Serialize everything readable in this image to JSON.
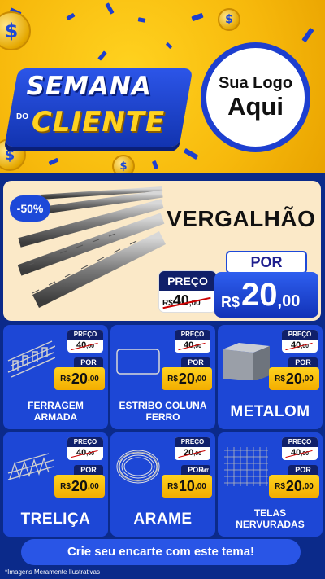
{
  "header": {
    "headline_top": "SEMANA",
    "headline_small": "DO",
    "headline_bottom": "CLIENTE",
    "coin_symbol": "$",
    "logo_line1": "Sua Logo",
    "logo_line2": "Aqui"
  },
  "featured": {
    "discount": "-50%",
    "title": "VERGALHÃO",
    "old_label": "PREÇO",
    "old_currency": "R$",
    "old_int": "40",
    "old_dec": ",00",
    "por_label": "POR",
    "new_currency": "R$",
    "new_int": "20",
    "new_dec": ",00"
  },
  "cards": [
    {
      "name": "FERRAGEM ARMADA",
      "old_label": "PREÇO",
      "old_int": "40",
      "old_dec": ",00",
      "por": "POR",
      "cur": "R$",
      "new_int": "20",
      "new_dec": ",00"
    },
    {
      "name": "ESTRIBO COLUNA FERRO",
      "old_label": "PREÇO",
      "old_int": "40",
      "old_dec": ",00",
      "por": "POR",
      "cur": "R$",
      "new_int": "20",
      "new_dec": ",00"
    },
    {
      "name": "METALOM",
      "old_label": "PREÇO",
      "old_int": "40",
      "old_dec": ",00",
      "por": "POR",
      "cur": "R$",
      "new_int": "20",
      "new_dec": ",00"
    },
    {
      "name": "TRELIÇA",
      "old_label": "PREÇO",
      "old_int": "40",
      "old_dec": ",00",
      "por": "POR",
      "cur": "R$",
      "new_int": "20",
      "new_dec": ",00"
    },
    {
      "name": "ARAME",
      "old_label": "PREÇO",
      "old_int": "20",
      "old_dec": ",00",
      "por": "POR",
      "cur": "R$",
      "new_int": "10",
      "new_dec": ",00",
      "unit": "MT"
    },
    {
      "name": "TELAS NERVURADAS",
      "old_label": "PREÇO",
      "old_int": "40",
      "old_dec": ",00",
      "por": "POR",
      "cur": "R$",
      "new_int": "20",
      "new_dec": ",00"
    }
  ],
  "cta": "Crie seu encarte com este tema!",
  "footnote": "*Imagens Meramente Ilustrativas",
  "colors": {
    "brand_blue": "#1d47d6",
    "yellow": "#ffd21f",
    "dark_navy": "#0b2a8a"
  }
}
